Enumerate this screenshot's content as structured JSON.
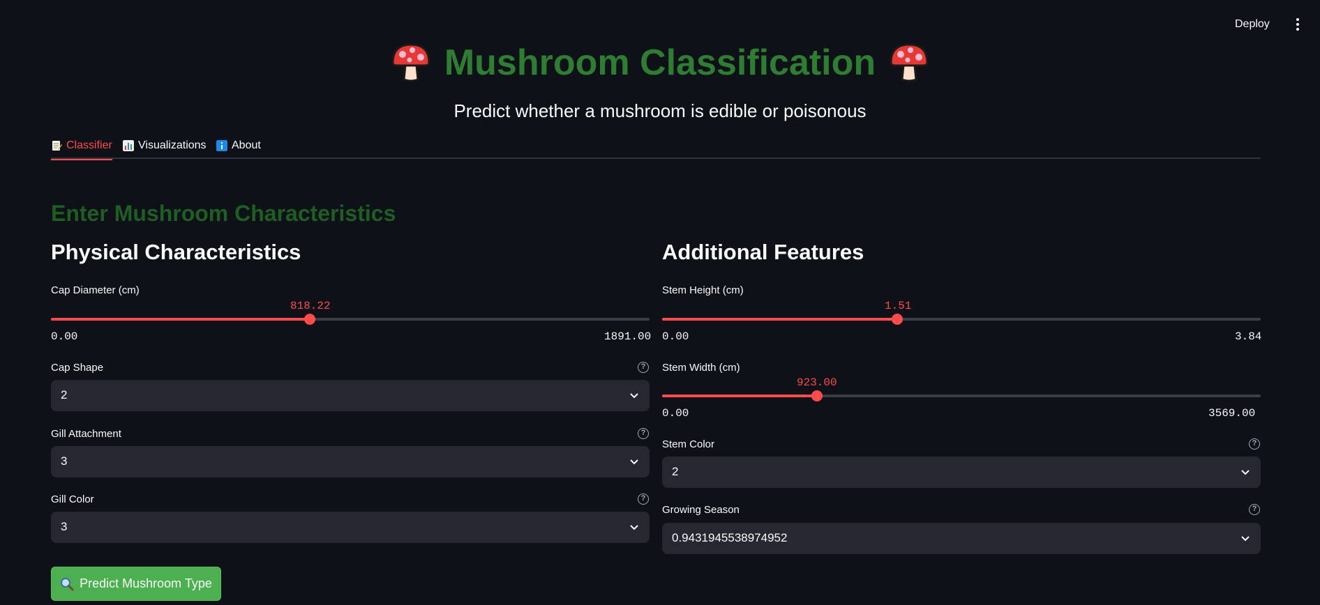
{
  "header": {
    "deploy_label": "Deploy",
    "menu_icon": "more-vertical-icon"
  },
  "title": {
    "text": "Mushroom Classification",
    "icon": "mushroom-icon",
    "color": "#2e7d32"
  },
  "subtitle": "Predict whether a mushroom is edible or poisonous",
  "tabs": [
    {
      "icon": "memo-icon",
      "label": "Classifier",
      "active": true
    },
    {
      "icon": "bar-chart-icon",
      "label": "Visualizations",
      "active": false
    },
    {
      "icon": "info-icon",
      "label": "About",
      "active": false
    }
  ],
  "section_heading": "Enter Mushroom Characteristics",
  "left": {
    "heading": "Physical Characteristics",
    "cap_diameter": {
      "label": "Cap Diameter (cm)",
      "value": "818.22",
      "min": "0.00",
      "max": "1891.00",
      "fraction": 0.4327
    },
    "cap_shape": {
      "label": "Cap Shape",
      "value": "2"
    },
    "gill_attachment": {
      "label": "Gill Attachment",
      "value": "3"
    },
    "gill_color": {
      "label": "Gill Color",
      "value": "3"
    }
  },
  "right": {
    "heading": "Additional Features",
    "stem_height": {
      "label": "Stem Height (cm)",
      "value": "1.51",
      "min": "0.00",
      "max": "3.84",
      "fraction": 0.3932
    },
    "stem_width": {
      "label": "Stem Width (cm)",
      "value": "923.00",
      "min": "0.00",
      "max": "3569.00",
      "fraction": 0.2586
    },
    "stem_color": {
      "label": "Stem Color",
      "value": "2"
    },
    "growing_season": {
      "label": "Growing Season",
      "value": "0.9431945538974952"
    }
  },
  "predict_button": {
    "label": "Predict Mushroom Type",
    "icon": "magnifier-icon"
  },
  "colors": {
    "background": "#0e1117",
    "accent": "#ff4b4b",
    "select_bg": "#262730",
    "button_green": "#4caf50",
    "heading_green": "#1e5e22"
  }
}
